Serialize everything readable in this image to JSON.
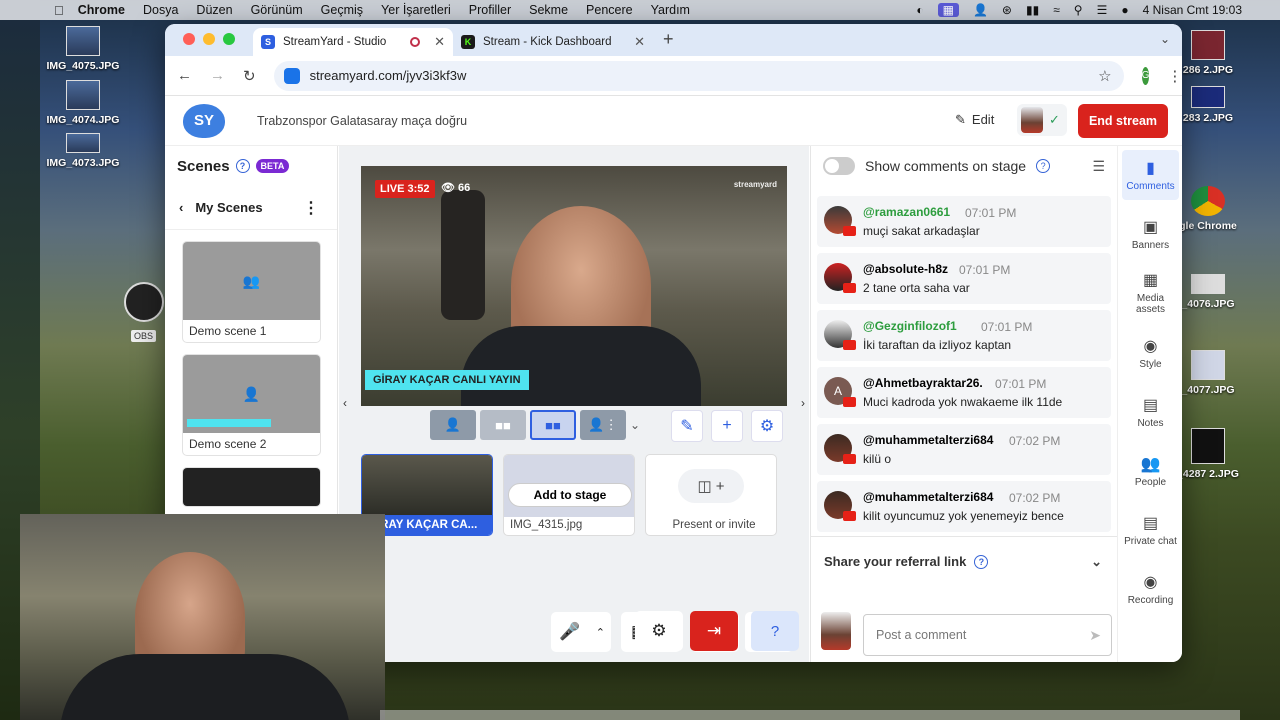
{
  "menubar": {
    "apple": "",
    "items": [
      "Chrome",
      "Dosya",
      "Düzen",
      "Görünüm",
      "Geçmiş",
      "Yer İşaretleri",
      "Profiller",
      "Sekme",
      "Pencere",
      "Yardım"
    ],
    "clock": "4 Nisan Cmt  19:03"
  },
  "desktop": {
    "icons_left": [
      "IMG_4075.JPG",
      "IMG_4074.JPG",
      "IMG_4073.JPG"
    ],
    "icons_right": [
      "286 2.JPG",
      "283 2.JPG",
      "gle Chrome",
      "_4076.JPG",
      "_4077.JPG",
      "_4287 2.JPG"
    ],
    "obs_label": "OBS"
  },
  "browser": {
    "tabs": [
      {
        "title": "StreamYard - Studio",
        "active": true
      },
      {
        "title": "Stream - Kick Dashboard",
        "active": false
      }
    ],
    "url": "streamyard.com/jyv3i3kf3w",
    "profile_initial": "G"
  },
  "header": {
    "logo": "SY",
    "broadcast_title": "Trabzonspor Galatasaray maça doğru",
    "edit_label": "Edit",
    "end_stream_label": "End stream"
  },
  "scenes": {
    "title": "Scenes",
    "beta": "BETA",
    "folder": "My Scenes",
    "items": [
      {
        "label": "Demo scene 1"
      },
      {
        "label": "Demo scene 2"
      }
    ]
  },
  "stage": {
    "live_badge": "LIVE 3:52",
    "viewers": "66",
    "watermark": "streamyard",
    "lower_third": "GİRAY KAÇAR CANLI YAYIN",
    "sources": [
      {
        "label": "GİRAY KAÇAR CA..."
      },
      {
        "label": "IMG_4315.jpg",
        "hover_button": "Add to stage"
      }
    ],
    "present_label": "Present or invite"
  },
  "comments_panel": {
    "toggle_label": "Show comments on stage",
    "comments": [
      {
        "user": "@ramazan0661",
        "time": "07:01 PM",
        "text": "muçi sakat arkadaşlar",
        "verified": true
      },
      {
        "user": "@absolute-h8z",
        "time": "07:01 PM",
        "text": "2 tane orta saha var",
        "verified": false
      },
      {
        "user": "@Gezginfilozof1",
        "time": "07:01 PM",
        "text": "İki taraftan da izliyoz kaptan",
        "verified": true
      },
      {
        "user": "@Ahmetbayraktar26.",
        "time": "07:01 PM",
        "text": "Muci kadroda yok nwakaeme ilk 11de",
        "verified": false
      },
      {
        "user": "@muhammetalterzi684",
        "time": "07:02 PM",
        "text": "kilü o",
        "verified": false
      },
      {
        "user": "@muhammetalterzi684",
        "time": "07:02 PM",
        "text": "kilit oyuncumuz yok yenemeyiz bence",
        "verified": false
      }
    ],
    "referral": "Share your referral link",
    "post_placeholder": "Post a comment"
  },
  "sidebar": {
    "items": [
      {
        "label": "Comments",
        "icon": "comments-icon",
        "active": true
      },
      {
        "label": "Banners",
        "icon": "banners-icon"
      },
      {
        "label": "Media assets",
        "icon": "media-icon"
      },
      {
        "label": "Style",
        "icon": "palette-icon"
      },
      {
        "label": "Notes",
        "icon": "notes-icon"
      },
      {
        "label": "People",
        "icon": "people-icon"
      },
      {
        "label": "Private chat",
        "icon": "chat-icon"
      },
      {
        "label": "Recording",
        "icon": "record-icon"
      }
    ]
  },
  "colors": {
    "accent": "#2e5fe0",
    "end_stream": "#d9231d",
    "live": "#d9231d",
    "lower_third": "#4fe3ef",
    "username": "#2d9d3e"
  }
}
